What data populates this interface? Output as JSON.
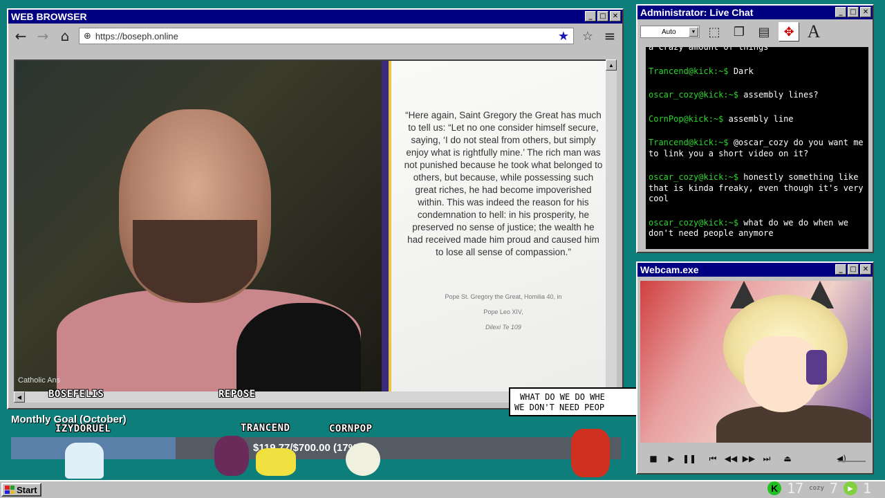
{
  "browser": {
    "title": "WEB BROWSER",
    "url": "https://boseph.online",
    "quote": "“Here again, Saint Gregory the Great has much to tell us: “Let no one consider himself secure, saying, ‘I do not steal from others, but simply enjoy what is rightfully mine.’ The rich man was not punished because he took what belonged to others, but because, while possessing such great riches, he had become impoverished within. This was indeed the reason for his condemnation to hell: in his prosperity, he preserved no sense of justice; the wealth he had received made him proud and caused him to lose all sense of compassion.”",
    "cite_line1": "Pope St. Gregory the Great, Homilia 40, in",
    "cite_line2": "Pope Leo XIV,",
    "cite_line3": "Dilexi Te 109",
    "logo_text": "Catholic Ans"
  },
  "overlay": {
    "names": {
      "bosefelis": "BOSEFELIS",
      "repose": "REPOSE",
      "izydoruel": "IZYDORUEL",
      "trancend": "TRANCEND",
      "cornpop": "CORNPOP"
    },
    "bubble_line1": "WHAT DO WE DO WHE",
    "bubble_line2": "WE DON'T NEED PEOP",
    "goal_title": "Monthly Goal (October)",
    "goal_amount": "$119.77/$700.00 (17%)",
    "goal_progress": 0.27
  },
  "chat": {
    "title": "Administrator: Live Chat",
    "font_size_value": "Auto",
    "messages": [
      {
        "user": "",
        "text": "a crazy amount of things"
      },
      {
        "user": "Trancend@kick:~$",
        "text": " Dark"
      },
      {
        "user": "oscar_cozy@kick:~$",
        "text": " assembly lines?"
      },
      {
        "user": "CornPop@kick:~$",
        "text": " assembly line"
      },
      {
        "user": "Trancend@kick:~$",
        "text": " @oscar_cozy do you want me to link you a short video on it?"
      },
      {
        "user": "oscar_cozy@kick:~$",
        "text": " honestly something like that is kinda freaky, even though it's very cool"
      },
      {
        "user": "oscar_cozy@kick:~$",
        "text": " what do we do when we don't need people anymore"
      }
    ]
  },
  "webcam": {
    "title": "Webcam.exe"
  },
  "taskbar": {
    "start_label": "Start",
    "tray_num1": "17",
    "tray_num2": "7",
    "tray_num3": "1",
    "tray_small": "cozy"
  },
  "colors": {
    "desktop": "#0d7e7a",
    "titlebar": "#000080",
    "chat_user": "#2bd62b"
  }
}
